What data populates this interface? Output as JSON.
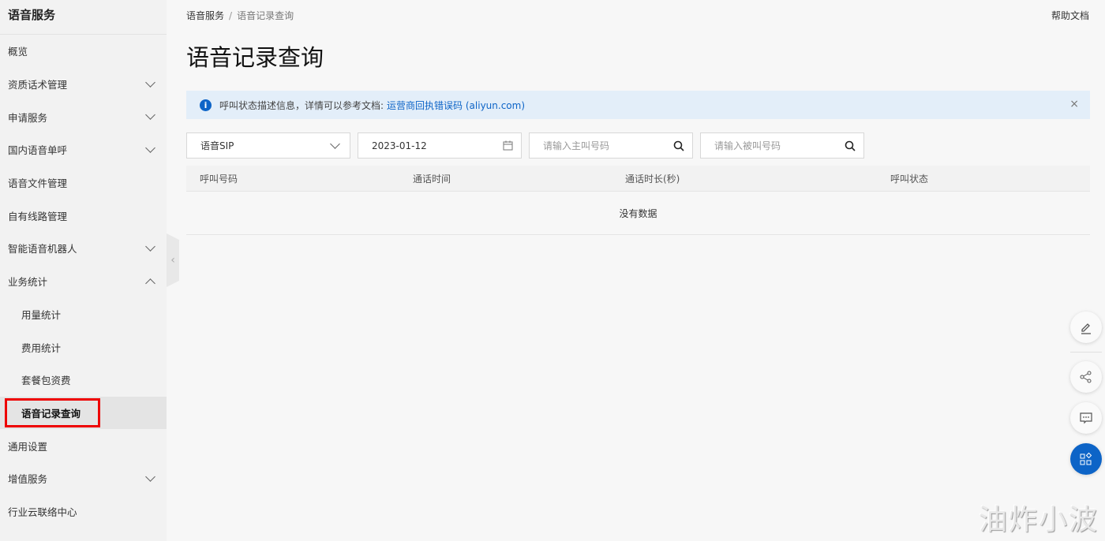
{
  "sidebar": {
    "title": "语音服务",
    "items": [
      {
        "label": "概览"
      },
      {
        "label": "资质话术管理"
      },
      {
        "label": "申请服务"
      },
      {
        "label": "国内语音单呼"
      },
      {
        "label": "语音文件管理"
      },
      {
        "label": "自有线路管理"
      },
      {
        "label": "智能语音机器人"
      },
      {
        "label": "业务统计"
      },
      {
        "label": "用量统计"
      },
      {
        "label": "费用统计"
      },
      {
        "label": "套餐包资费"
      },
      {
        "label": "语音记录查询"
      },
      {
        "label": "通用设置"
      },
      {
        "label": "增值服务"
      },
      {
        "label": "行业云联络中心"
      }
    ]
  },
  "breadcrumb": {
    "root": "语音服务",
    "sep": "/",
    "current": "语音记录查询"
  },
  "help": "帮助文档",
  "page_title": "语音记录查询",
  "alert": {
    "text": "呼叫状态描述信息，详情可以参考文档:",
    "link": "运营商回执错误码 (aliyun.com)",
    "close": "×"
  },
  "filters": {
    "type": "语音SIP",
    "date": "2023-01-12",
    "caller_placeholder": "请输入主叫号码",
    "callee_placeholder": "请输入被叫号码"
  },
  "table": {
    "columns": [
      "呼叫号码",
      "通话时间",
      "通话时长(秒)",
      "呼叫状态"
    ],
    "empty": "没有数据"
  },
  "watermark": "油炸小波",
  "colors": {
    "accent": "#0d64c7",
    "highlight": "#e00000"
  }
}
